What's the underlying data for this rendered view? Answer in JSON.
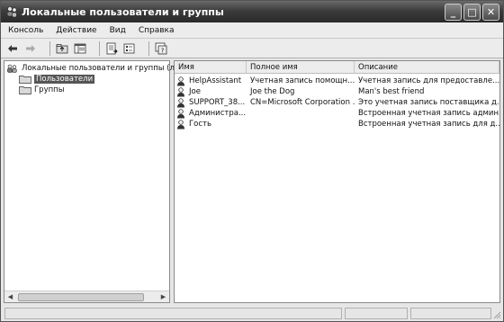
{
  "window": {
    "title": "Локальные пользователи и группы",
    "controls": {
      "minimize": "_",
      "maximize": "□",
      "close": "✕"
    }
  },
  "menu": [
    "Консоль",
    "Действие",
    "Вид",
    "Справка"
  ],
  "toolbar": {
    "icons": [
      "back-icon",
      "forward-icon",
      "up-folder-icon",
      "show-tree-icon",
      "export-list-icon",
      "properties-icon",
      "help-icon"
    ]
  },
  "tree": {
    "root": "Локальные пользователи и группы (лок",
    "users": "Пользователи",
    "groups": "Группы",
    "selected": "Пользователи"
  },
  "list": {
    "columns": [
      "Имя",
      "Полное имя",
      "Описание"
    ],
    "rows": [
      {
        "name": "HelpAssistant",
        "full_name": "Учетная запись помощн...",
        "description": "Учетная запись для предоставле..."
      },
      {
        "name": "Joe",
        "full_name": "Joe the Dog",
        "description": "Man's best friend"
      },
      {
        "name": "SUPPORT_38...",
        "full_name": "CN=Microsoft Corporation ...",
        "description": "Это учетная запись поставщика д..."
      },
      {
        "name": "Администра...",
        "full_name": "",
        "description": "Встроенная учетная запись админ..."
      },
      {
        "name": "Гость",
        "full_name": "",
        "description": "Встроенная учетная запись для д..."
      }
    ]
  }
}
